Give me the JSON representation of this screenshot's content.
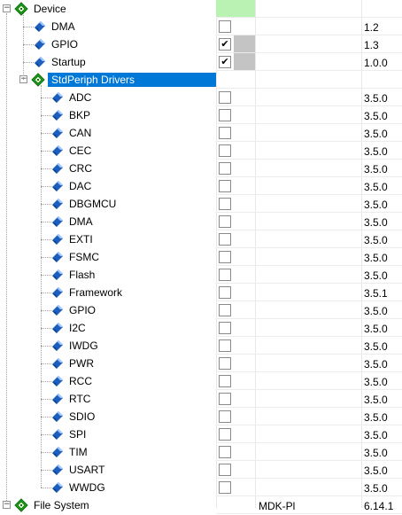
{
  "tree": {
    "device": {
      "label": "Device",
      "expander": "⊟",
      "icon": "green-diamond-icon"
    },
    "device_children": [
      {
        "label": "DMA",
        "checked": false,
        "version": "1.2"
      },
      {
        "label": "GPIO",
        "checked": true,
        "version": "1.3"
      },
      {
        "label": "Startup",
        "checked": true,
        "version": "1.0.0"
      }
    ],
    "stdperiph": {
      "label": "StdPeriph Drivers",
      "expander": "⊟",
      "selected": true
    },
    "drivers": [
      {
        "label": "ADC",
        "checked": false,
        "version": "3.5.0"
      },
      {
        "label": "BKP",
        "checked": false,
        "version": "3.5.0"
      },
      {
        "label": "CAN",
        "checked": false,
        "version": "3.5.0"
      },
      {
        "label": "CEC",
        "checked": false,
        "version": "3.5.0"
      },
      {
        "label": "CRC",
        "checked": false,
        "version": "3.5.0"
      },
      {
        "label": "DAC",
        "checked": false,
        "version": "3.5.0"
      },
      {
        "label": "DBGMCU",
        "checked": false,
        "version": "3.5.0"
      },
      {
        "label": "DMA",
        "checked": false,
        "version": "3.5.0"
      },
      {
        "label": "EXTI",
        "checked": false,
        "version": "3.5.0"
      },
      {
        "label": "FSMC",
        "checked": false,
        "version": "3.5.0"
      },
      {
        "label": "Flash",
        "checked": false,
        "version": "3.5.0"
      },
      {
        "label": "Framework",
        "checked": false,
        "version": "3.5.1"
      },
      {
        "label": "GPIO",
        "checked": false,
        "version": "3.5.0"
      },
      {
        "label": "I2C",
        "checked": false,
        "version": "3.5.0"
      },
      {
        "label": "IWDG",
        "checked": false,
        "version": "3.5.0"
      },
      {
        "label": "PWR",
        "checked": false,
        "version": "3.5.0"
      },
      {
        "label": "RCC",
        "checked": false,
        "version": "3.5.0"
      },
      {
        "label": "RTC",
        "checked": false,
        "version": "3.5.0"
      },
      {
        "label": "SDIO",
        "checked": false,
        "version": "3.5.0"
      },
      {
        "label": "SPI",
        "checked": false,
        "version": "3.5.0"
      },
      {
        "label": "TIM",
        "checked": false,
        "version": "3.5.0"
      },
      {
        "label": "USART",
        "checked": false,
        "version": "3.5.0"
      },
      {
        "label": "WWDG",
        "checked": false,
        "version": "3.5.0"
      }
    ],
    "partial_row": {
      "label": "File System",
      "variant": "MDK-Pl",
      "version": "6.14.1"
    }
  },
  "check_glyph": "✔",
  "colors": {
    "device_select_green": "#b9f2b3",
    "checked_cell_gray": "#c4c4c4",
    "selection_blue": "#0078d7",
    "component_blue": "#1c5fbf",
    "bundle_green": "#1fa01f"
  }
}
